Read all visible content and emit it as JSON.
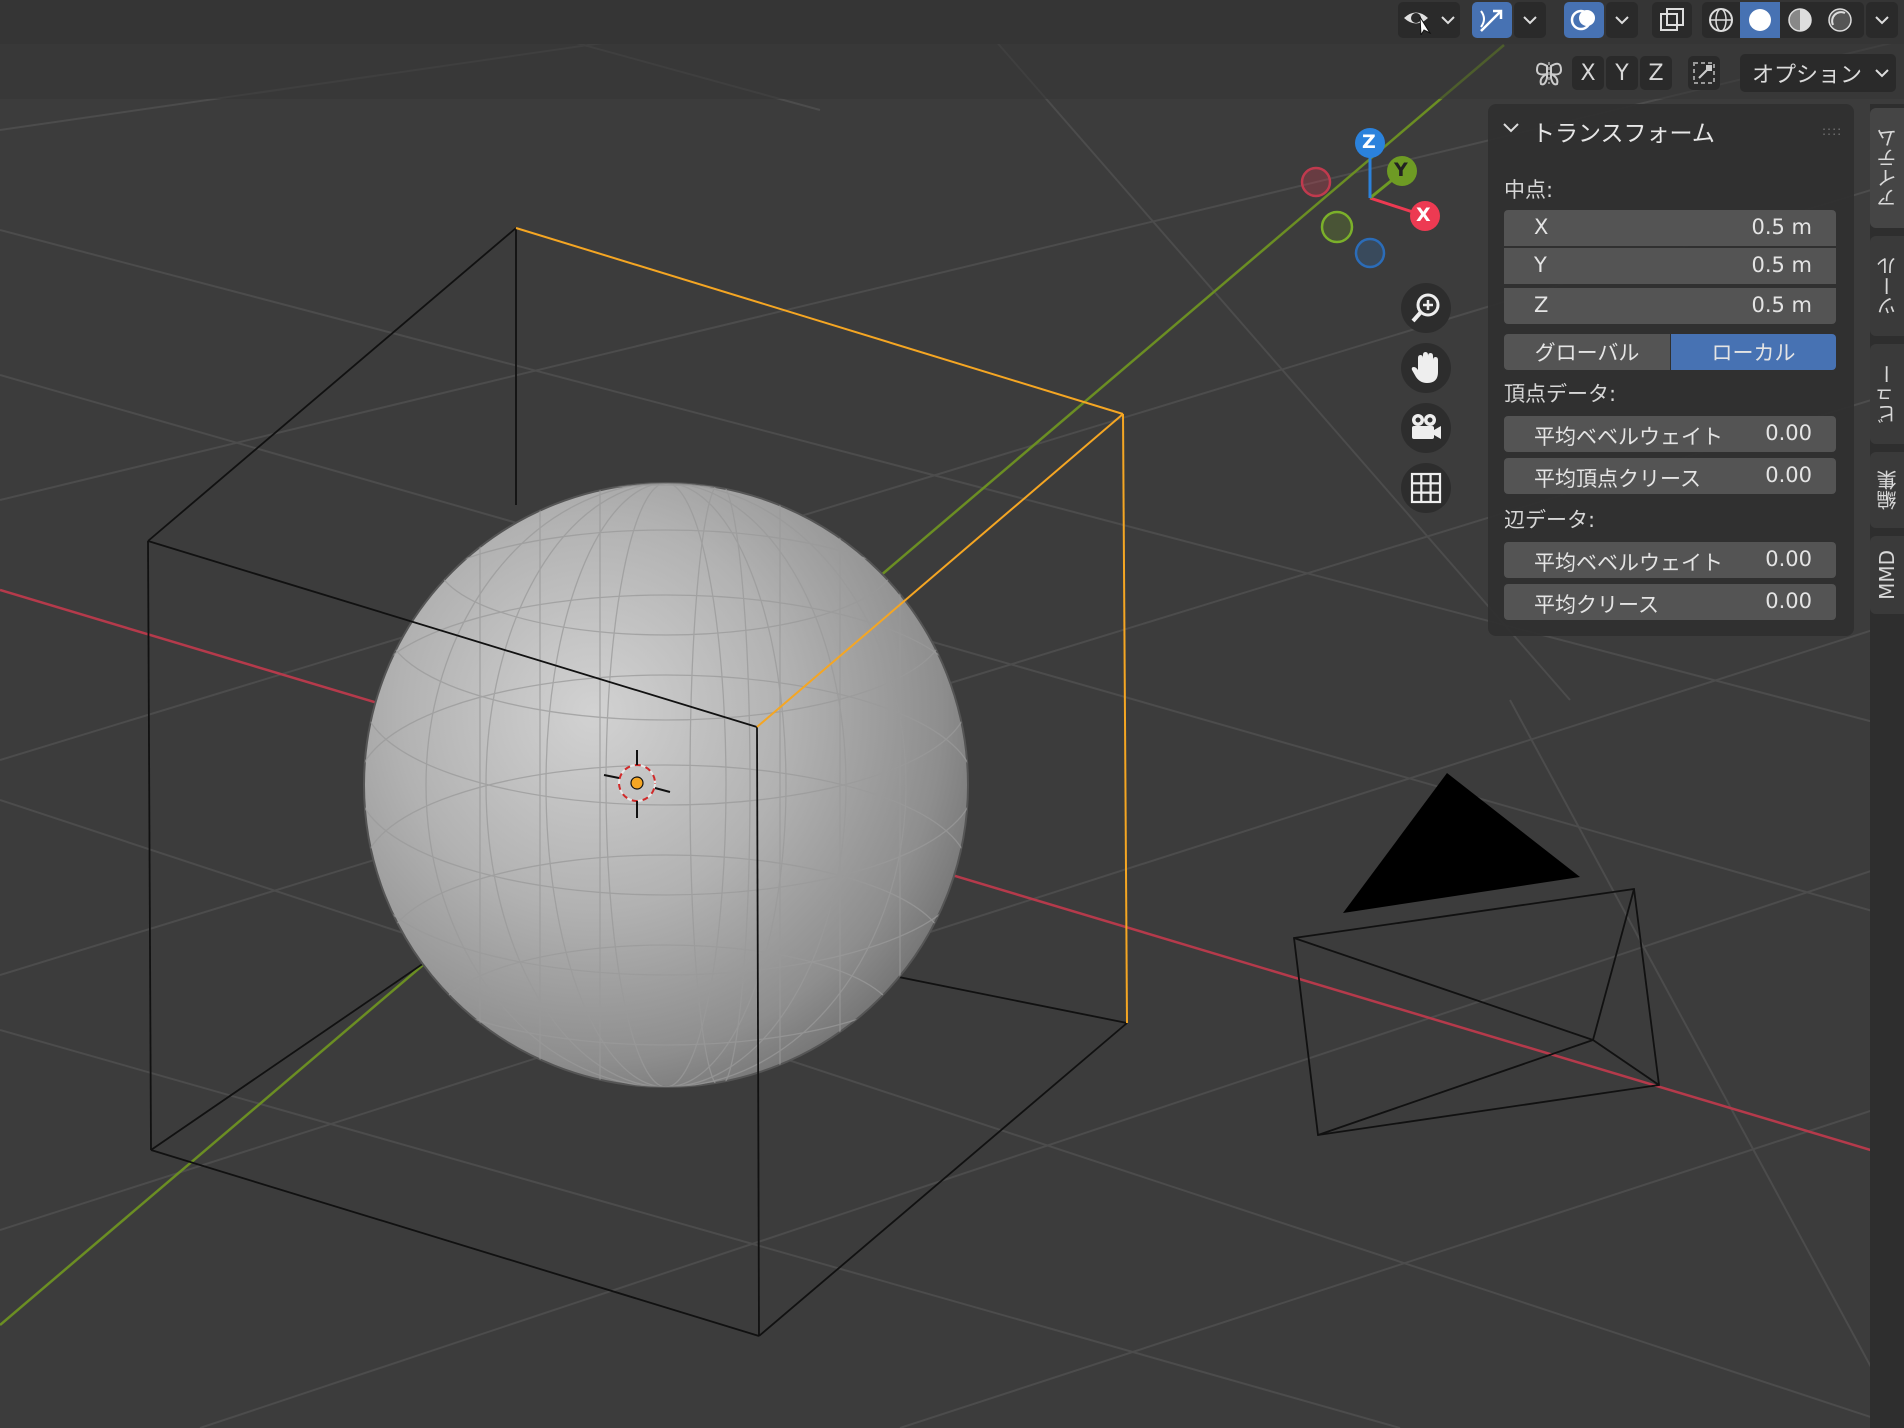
{
  "header": {
    "visibility_icon": "eye-arrow-icon",
    "gizmo_toggle_icon": "gizmo-arrow-icon",
    "overlay_toggle_icon": "overlay-circles-icon",
    "xray_icon": "xray-squares-icon",
    "shading_modes": [
      "wireframe",
      "solid",
      "material-preview",
      "rendered"
    ],
    "active_shading": "solid",
    "mirror_icon": "butterfly-mirror-icon",
    "axis_x": "X",
    "axis_y": "Y",
    "axis_z": "Z",
    "snap_icon": "snap-icon",
    "options_label": "オプション"
  },
  "gizmo": {
    "x_label": "X",
    "y_label": "Y",
    "z_label": "Z",
    "colors": {
      "x": "#ed3a52",
      "y": "#6e9b24",
      "z": "#2b82dc"
    }
  },
  "nav": {
    "zoom_icon": "zoom-icon",
    "pan_icon": "hand-icon",
    "camera_icon": "camera-icon",
    "grid_icon": "grid-ortho-icon"
  },
  "panel": {
    "title": "トランスフォーム",
    "median_label": "中点:",
    "x_label": "X",
    "x_value": "0.5 m",
    "y_label": "Y",
    "y_value": "0.5 m",
    "z_label": "Z",
    "z_value": "0.5 m",
    "global_label": "グローバル",
    "local_label": "ローカル",
    "active_space": "local",
    "vertex_data_label": "頂点データ:",
    "vertex_bevel_label": "平均ベベルウェイト",
    "vertex_bevel_value": "0.00",
    "vertex_crease_label": "平均頂点クリース",
    "vertex_crease_value": "0.00",
    "edge_data_label": "辺データ:",
    "edge_bevel_label": "平均ベベルウェイト",
    "edge_bevel_value": "0.00",
    "edge_crease_label": "平均クリース",
    "edge_crease_value": "0.00"
  },
  "tabs": [
    "アイテム",
    "ツール",
    "ビュー",
    "編集",
    "MMD"
  ],
  "active_tab": "アイテム",
  "colors": {
    "viewport_bg": "#3c3c3c",
    "grid_line": "#4a4a4a",
    "x_axis": "#b8384a",
    "y_axis": "#6b8e23",
    "selected_edge": "#f5a623",
    "accent": "#4772b3"
  }
}
